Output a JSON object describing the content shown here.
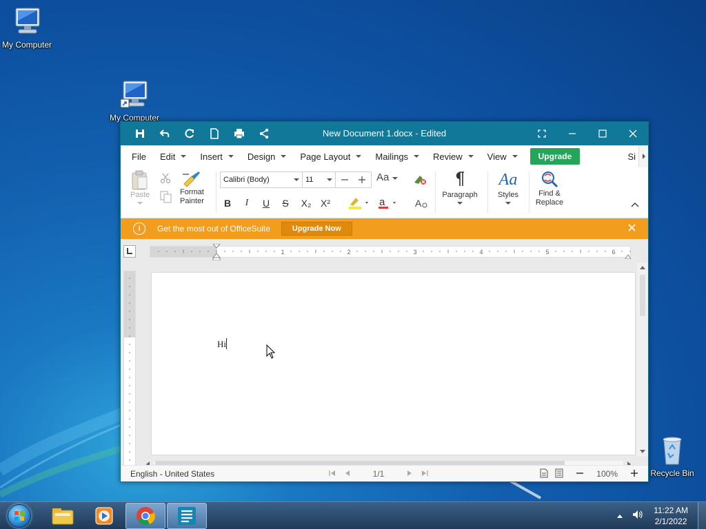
{
  "desktop": {
    "icons": [
      {
        "label": "My Computer"
      },
      {
        "label": "My Computer"
      },
      {
        "label": "Recycle Bin"
      }
    ]
  },
  "window": {
    "title": "New Document 1.docx - Edited",
    "toolbar_icons": [
      "save-icon",
      "undo-icon",
      "redo-icon",
      "new-document-icon",
      "print-icon",
      "share-icon"
    ],
    "controls": [
      "fullscreen-icon",
      "minimize-icon",
      "maximize-icon",
      "close-icon"
    ]
  },
  "menu": {
    "items": [
      {
        "label": "File",
        "dropdown": false
      },
      {
        "label": "Edit",
        "dropdown": true
      },
      {
        "label": "Insert",
        "dropdown": true
      },
      {
        "label": "Design",
        "dropdown": true
      },
      {
        "label": "Page Layout",
        "dropdown": true
      },
      {
        "label": "Mailings",
        "dropdown": true
      },
      {
        "label": "Review",
        "dropdown": true
      },
      {
        "label": "View",
        "dropdown": true
      }
    ],
    "upgrade_label": "Upgrade",
    "overflow_label": "Si"
  },
  "ribbon": {
    "paste_label": "Paste",
    "format_painter_label1": "Format",
    "format_painter_label2": "Painter",
    "font_name": "Calibri (Body)",
    "font_size": "11",
    "change_case_label": "Aa",
    "bold_label": "B",
    "italic_label": "I",
    "underline_label": "U",
    "strike_label": "S",
    "subscript_label": "X₂",
    "superscript_label": "X²",
    "paragraph_label": "Paragraph",
    "styles_label": "Styles",
    "styles_glyph": "Aa",
    "find_label1": "Find &",
    "find_label2": "Replace"
  },
  "banner": {
    "message": "Get the most out of OfficeSuite",
    "button": "Upgrade Now"
  },
  "ruler": {
    "numbers": [
      "1",
      "2",
      "3",
      "4",
      "5",
      "6"
    ]
  },
  "document": {
    "text": "Hi"
  },
  "status": {
    "language": "English - United States",
    "page": "1/1",
    "zoom": "100%"
  },
  "taskbar": {
    "apps": [
      "file-explorer-icon",
      "media-player-icon",
      "chrome-icon",
      "officesuite-icon"
    ],
    "time": "11:22 AM",
    "date": "2/1/2022"
  },
  "colors": {
    "titlebar": "#11789a",
    "upgrade": "#23a55a",
    "banner": "#f29d1d"
  }
}
